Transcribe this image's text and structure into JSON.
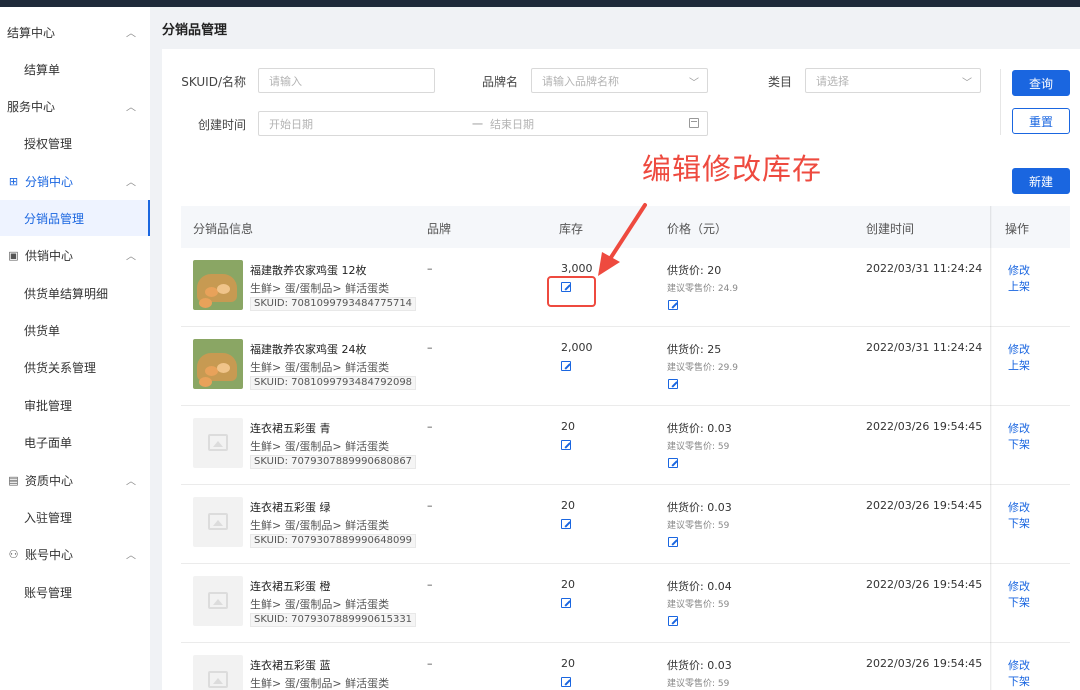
{
  "sidebar": {
    "groups": [
      {
        "label": "结算中心",
        "icon": "settlement-icon",
        "items": [
          {
            "label": "结算单"
          }
        ]
      },
      {
        "label": "服务中心",
        "icon": "service-icon",
        "items": [
          {
            "label": "授权管理"
          }
        ]
      },
      {
        "label": "分销中心",
        "icon": "grid-icon",
        "items": [
          {
            "label": "分销品管理"
          }
        ]
      },
      {
        "label": "供销中心",
        "icon": "supply-icon",
        "items": [
          {
            "label": "供货单结算明细"
          },
          {
            "label": "供货单"
          },
          {
            "label": "供货关系管理"
          },
          {
            "label": "审批管理"
          },
          {
            "label": "电子面单"
          }
        ]
      },
      {
        "label": "资质中心",
        "icon": "qualification-icon",
        "items": [
          {
            "label": "入驻管理"
          }
        ]
      },
      {
        "label": "账号中心",
        "icon": "user-icon",
        "items": [
          {
            "label": "账号管理"
          }
        ]
      }
    ],
    "active_group": "分销中心",
    "active_item": "分销品管理"
  },
  "page": {
    "title": "分销品管理"
  },
  "filters": {
    "sku_label": "SKUID/名称",
    "sku_placeholder": "请输入",
    "brand_label": "品牌名",
    "brand_placeholder": "请输入品牌名称",
    "category_label": "类目",
    "category_placeholder": "请选择",
    "created_label": "创建时间",
    "start_placeholder": "开始日期",
    "date_separator": "一",
    "end_placeholder": "结束日期"
  },
  "buttons": {
    "search": "查询",
    "reset": "重置",
    "create": "新建"
  },
  "annotation": {
    "text": "编辑修改库存",
    "color": "#ee4a3f"
  },
  "table": {
    "headers": {
      "info": "分销品信息",
      "brand": "品牌",
      "stock": "库存",
      "price": "价格（元）",
      "created": "创建时间",
      "ops": "操作"
    },
    "rows": [
      {
        "image": "egg",
        "name": "福建散养农家鸡蛋 12枚",
        "category": "生鲜> 蛋/蛋制品> 鲜活蛋类",
        "sku": "SKUID: 7081099793484775714",
        "brand": "–",
        "stock": "3,000",
        "supply": "供货价: 20",
        "retail": "建议零售价: 24.9",
        "created": "2022/03/31 11:24:24",
        "op_edit": "修改",
        "op_status": "上架"
      },
      {
        "image": "egg",
        "name": "福建散养农家鸡蛋 24枚",
        "category": "生鲜> 蛋/蛋制品> 鲜活蛋类",
        "sku": "SKUID: 7081099793484792098",
        "brand": "–",
        "stock": "2,000",
        "supply": "供货价: 25",
        "retail": "建议零售价: 29.9",
        "created": "2022/03/31 11:24:24",
        "op_edit": "修改",
        "op_status": "上架"
      },
      {
        "image": "placeholder",
        "name": "连衣裙五彩蛋 青",
        "category": "生鲜> 蛋/蛋制品> 鲜活蛋类",
        "sku": "SKUID: 7079307889990680867",
        "brand": "–",
        "stock": "20",
        "supply": "供货价: 0.03",
        "retail": "建议零售价: 59",
        "created": "2022/03/26 19:54:45",
        "op_edit": "修改",
        "op_status": "下架"
      },
      {
        "image": "placeholder",
        "name": "连衣裙五彩蛋 绿",
        "category": "生鲜> 蛋/蛋制品> 鲜活蛋类",
        "sku": "SKUID: 7079307889990648099",
        "brand": "–",
        "stock": "20",
        "supply": "供货价: 0.03",
        "retail": "建议零售价: 59",
        "created": "2022/03/26 19:54:45",
        "op_edit": "修改",
        "op_status": "下架"
      },
      {
        "image": "placeholder",
        "name": "连衣裙五彩蛋 橙",
        "category": "生鲜> 蛋/蛋制品> 鲜活蛋类",
        "sku": "SKUID: 7079307889990615331",
        "brand": "–",
        "stock": "20",
        "supply": "供货价: 0.04",
        "retail": "建议零售价: 59",
        "created": "2022/03/26 19:54:45",
        "op_edit": "修改",
        "op_status": "下架"
      },
      {
        "image": "placeholder",
        "name": "连衣裙五彩蛋 蓝",
        "category": "生鲜> 蛋/蛋制品> 鲜活蛋类",
        "sku": "",
        "brand": "–",
        "stock": "20",
        "supply": "供货价: 0.03",
        "retail": "建议零售价: 59",
        "created": "2022/03/26 19:54:45",
        "op_edit": "修改",
        "op_status": "下架"
      }
    ]
  },
  "colors": {
    "accent": "#1a66e0",
    "annotation": "#ee4a3f"
  }
}
